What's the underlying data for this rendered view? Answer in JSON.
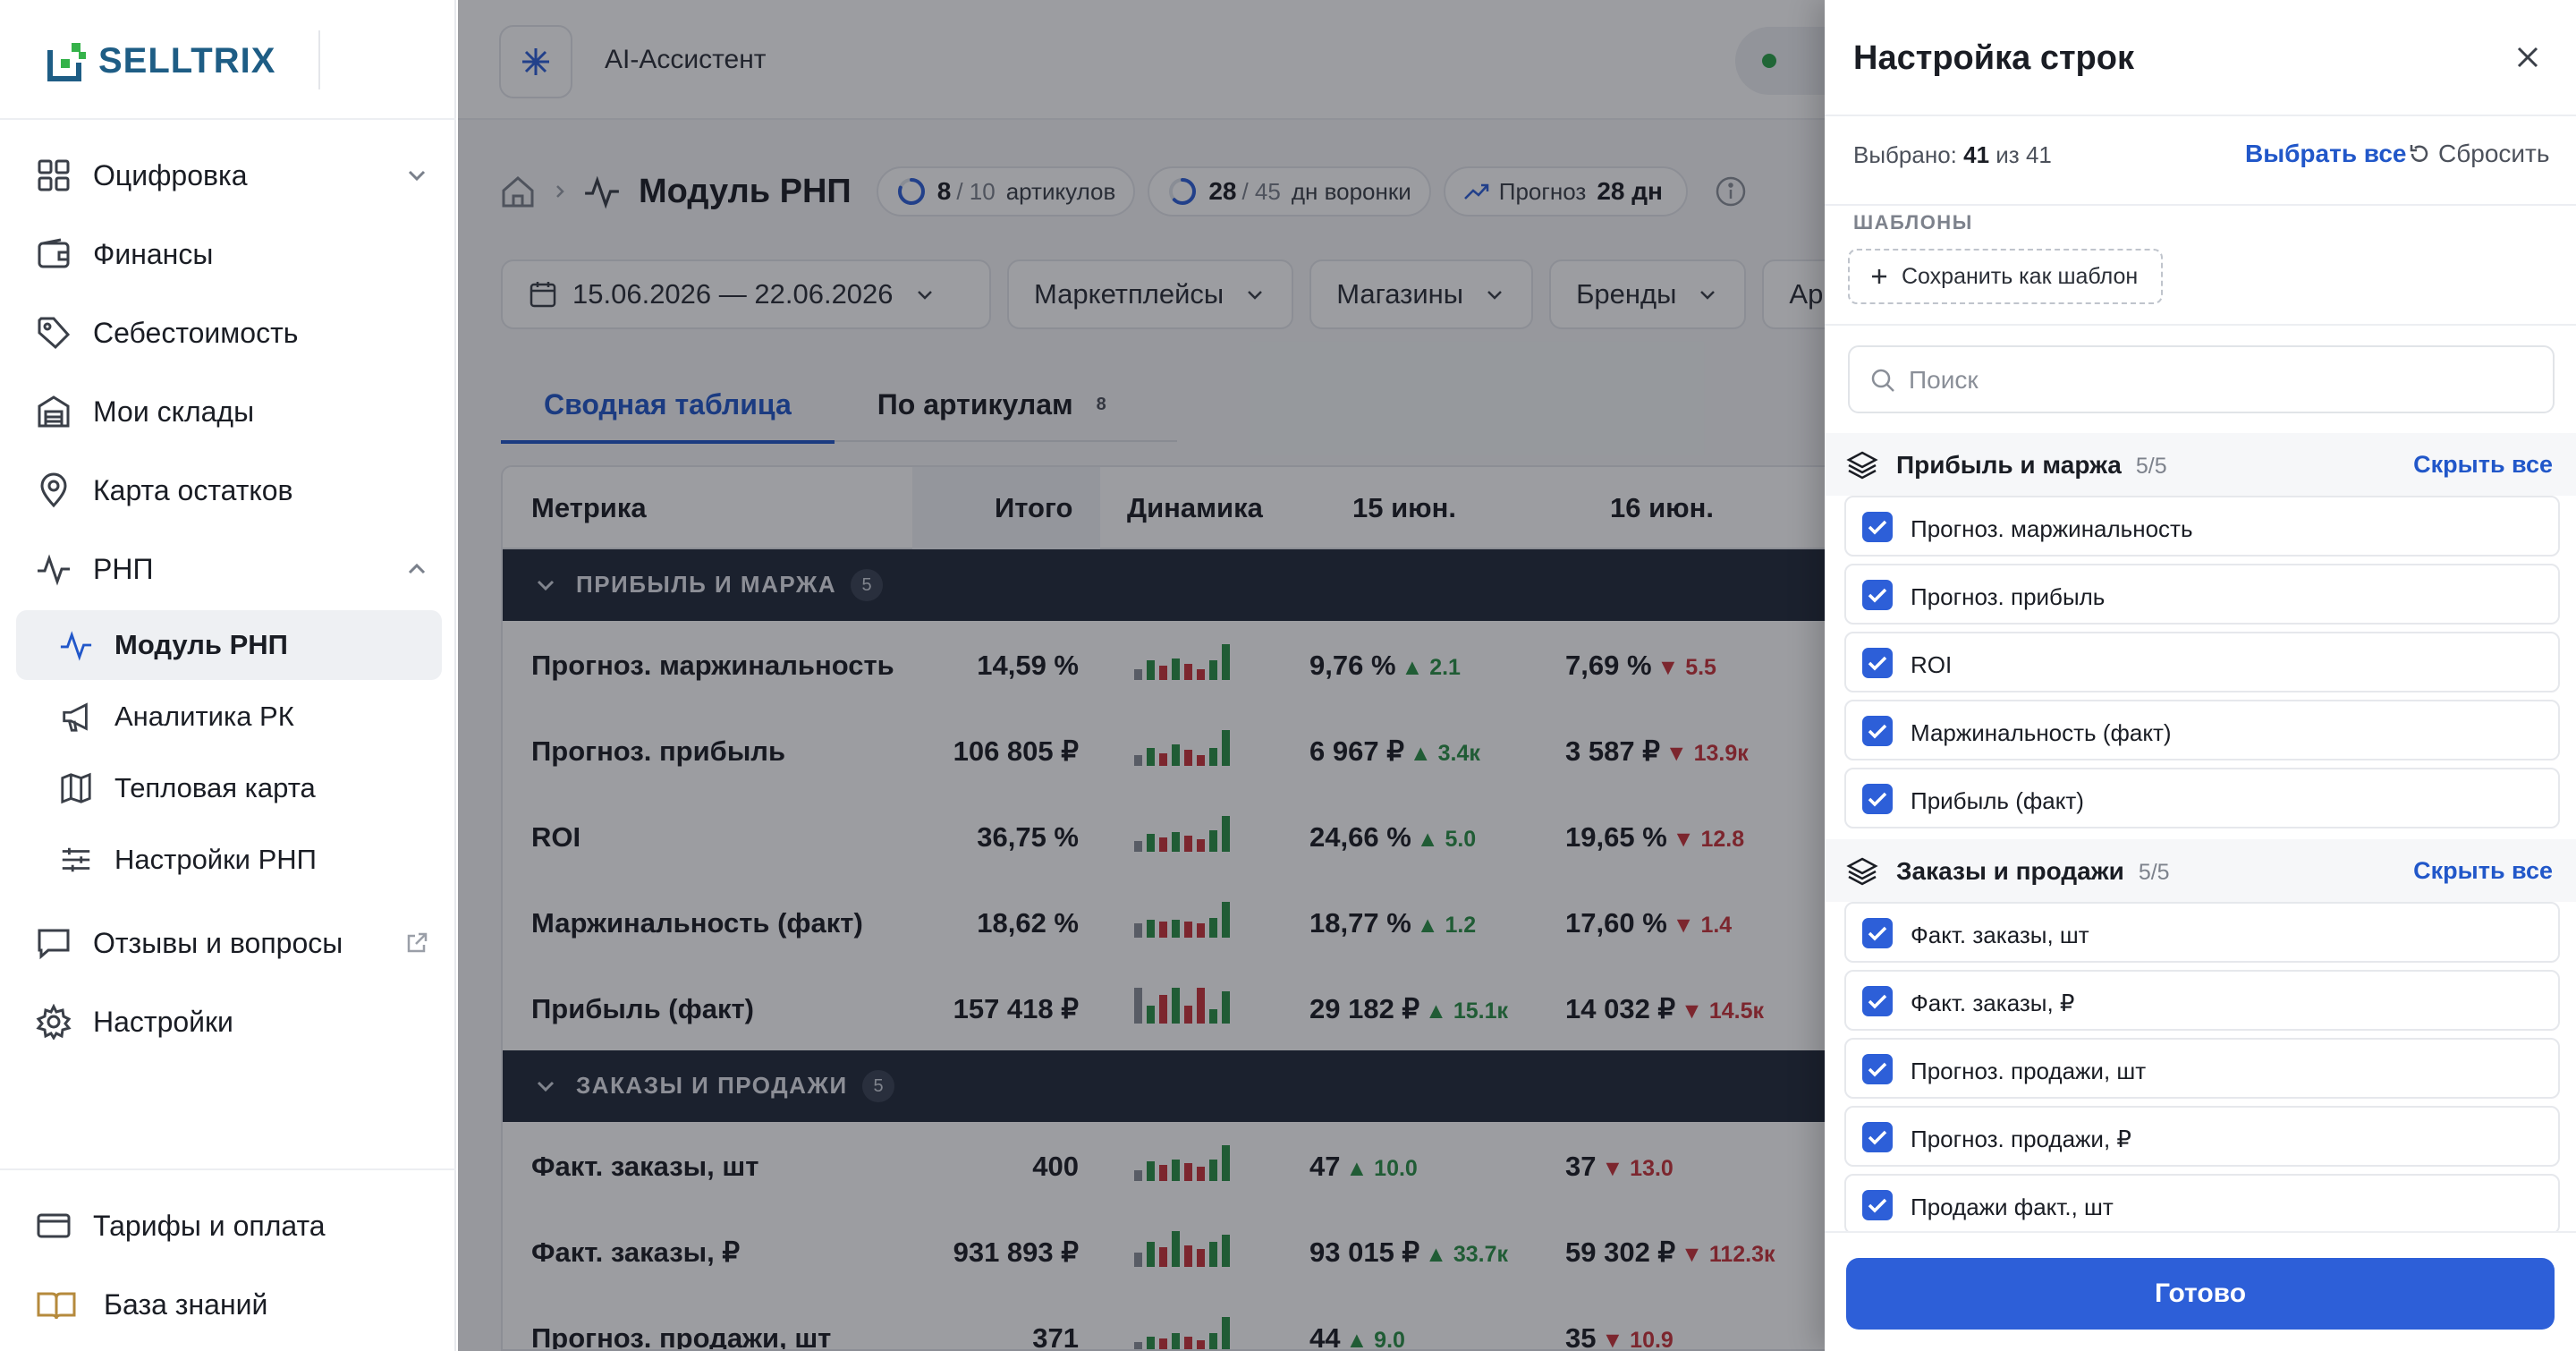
{
  "brand": {
    "logo_text": "SELLTRIX"
  },
  "sidebar": {
    "items": [
      {
        "label": "Оцифровка",
        "icon": "grid-icon"
      },
      {
        "label": "Финансы",
        "icon": "wallet-icon"
      },
      {
        "label": "Себестоимость",
        "icon": "tag-icon"
      },
      {
        "label": "Мои склады",
        "icon": "warehouse-icon"
      },
      {
        "label": "Карта остатков",
        "icon": "map-pin-icon"
      },
      {
        "label": "РНП",
        "icon": "pulse-icon"
      }
    ],
    "sub_items": [
      {
        "label": "Модуль РНП",
        "icon": "pulse-icon",
        "active": true
      },
      {
        "label": "Аналитика РК",
        "icon": "megaphone-icon"
      },
      {
        "label": "Тепловая карта",
        "icon": "map-icon"
      },
      {
        "label": "Настройки РНП",
        "icon": "sliders-icon"
      }
    ],
    "extra": [
      {
        "label": "Отзывы и вопросы",
        "icon": "message-icon"
      },
      {
        "label": "Настройки",
        "icon": "gear-icon"
      }
    ],
    "bottom": [
      {
        "label": "Тарифы и оплата",
        "icon": "card-icon"
      },
      {
        "label": "База знаний",
        "icon": "book-icon"
      }
    ]
  },
  "topbar": {
    "ai_label": "AI-Ассистент"
  },
  "breadcrumb": {
    "title": "Модуль РНП",
    "chips": [
      {
        "value": "8",
        "total": "/ 10",
        "label": "артикулов",
        "progress": 0.8
      },
      {
        "value": "28",
        "total": "/ 45",
        "label": "дн воронки",
        "progress": 0.62
      },
      {
        "prefix": "Прогноз",
        "value": "28 дн"
      }
    ]
  },
  "filters": {
    "date_range": "15.06.2026 — 22.06.2026",
    "marketplaces": "Маркетплейсы",
    "stores": "Магазины",
    "brands": "Бренды",
    "more": "Ар"
  },
  "tabs": [
    {
      "label": "Сводная таблица",
      "active": true
    },
    {
      "label": "По артикулам",
      "badge": "8"
    }
  ],
  "table": {
    "headers": {
      "metric": "Метрика",
      "total": "Итого",
      "dynamics": "Динамика",
      "d1": "15 июн.",
      "d2": "16 июн."
    },
    "groups": [
      {
        "name": "ПРИБЫЛЬ И МАРЖА",
        "count": "5",
        "rows": [
          {
            "name": "Прогноз. маржинальность",
            "total": "14,59 %",
            "d1": "9,76 %",
            "d1_delta": "▲ 2.1",
            "d1_dir": "up",
            "d2": "7,69 %",
            "d2_delta": "▼ 5.5",
            "d2_dir": "dn"
          },
          {
            "name": "Прогноз. прибыль",
            "total": "106 805 ₽",
            "d1": "6 967 ₽",
            "d1_delta": "▲ 3.4к",
            "d1_dir": "up",
            "d2": "3 587 ₽",
            "d2_delta": "▼ 13.9к",
            "d2_dir": "dn"
          },
          {
            "name": "ROI",
            "total": "36,75 %",
            "d1": "24,66 %",
            "d1_delta": "▲ 5.0",
            "d1_dir": "up",
            "d2": "19,65 %",
            "d2_delta": "▼ 12.8",
            "d2_dir": "dn"
          },
          {
            "name": "Маржинальность (факт)",
            "total": "18,62 %",
            "d1": "18,77 %",
            "d1_delta": "▲ 1.2",
            "d1_dir": "up",
            "d2": "17,60 %",
            "d2_delta": "▼ 1.4",
            "d2_dir": "dn"
          },
          {
            "name": "Прибыль (факт)",
            "total": "157 418 ₽",
            "d1": "29 182 ₽",
            "d1_delta": "▲ 15.1к",
            "d1_dir": "up",
            "d2": "14 032 ₽",
            "d2_delta": "▼ 14.5к",
            "d2_dir": "dn"
          }
        ]
      },
      {
        "name": "ЗАКАЗЫ И ПРОДАЖИ",
        "count": "5",
        "rows": [
          {
            "name": "Факт. заказы, шт",
            "total": "400",
            "d1": "47",
            "d1_delta": "▲ 10.0",
            "d1_dir": "up",
            "d2": "37",
            "d2_delta": "▼ 13.0",
            "d2_dir": "dn"
          },
          {
            "name": "Факт. заказы, ₽",
            "total": "931 893 ₽",
            "d1": "93 015 ₽",
            "d1_delta": "▲ 33.7к",
            "d1_dir": "up",
            "d2": "59 302 ₽",
            "d2_delta": "▼ 112.3к",
            "d2_dir": "dn"
          },
          {
            "name": "Прогноз. продажи, шт",
            "total": "371",
            "d1": "44",
            "d1_delta": "▲ 9.0",
            "d1_dir": "up",
            "d2": "35",
            "d2_delta": "▼ 10.9",
            "d2_dir": "dn"
          }
        ]
      }
    ]
  },
  "drawer": {
    "title": "Настройка строк",
    "selected_prefix": "Выбрано:",
    "selected_count": "41",
    "selected_of": "из 41",
    "select_all": "Выбрать все",
    "reset": "Сбросить",
    "templates_label": "ШАБЛОНЫ",
    "save_template": "Сохранить как шаблон",
    "search_placeholder": "Поиск",
    "hide_all": "Скрыть все",
    "sections": [
      {
        "name": "Прибыль и маржа",
        "count": "5/5",
        "options": [
          "Прогноз. маржинальность",
          "Прогноз. прибыль",
          "ROI",
          "Маржинальность (факт)",
          "Прибыль (факт)"
        ]
      },
      {
        "name": "Заказы и продажи",
        "count": "5/5",
        "options": [
          "Факт. заказы, шт",
          "Факт. заказы, ₽",
          "Прогноз. продажи, шт",
          "Прогноз. продажи, ₽",
          "Продажи факт., шт"
        ]
      }
    ],
    "done": "Готово"
  },
  "colors": {
    "accent": "#2d5fd8",
    "up": "#2a8f45",
    "down": "#c8323a",
    "group_bg": "#222a3a"
  }
}
